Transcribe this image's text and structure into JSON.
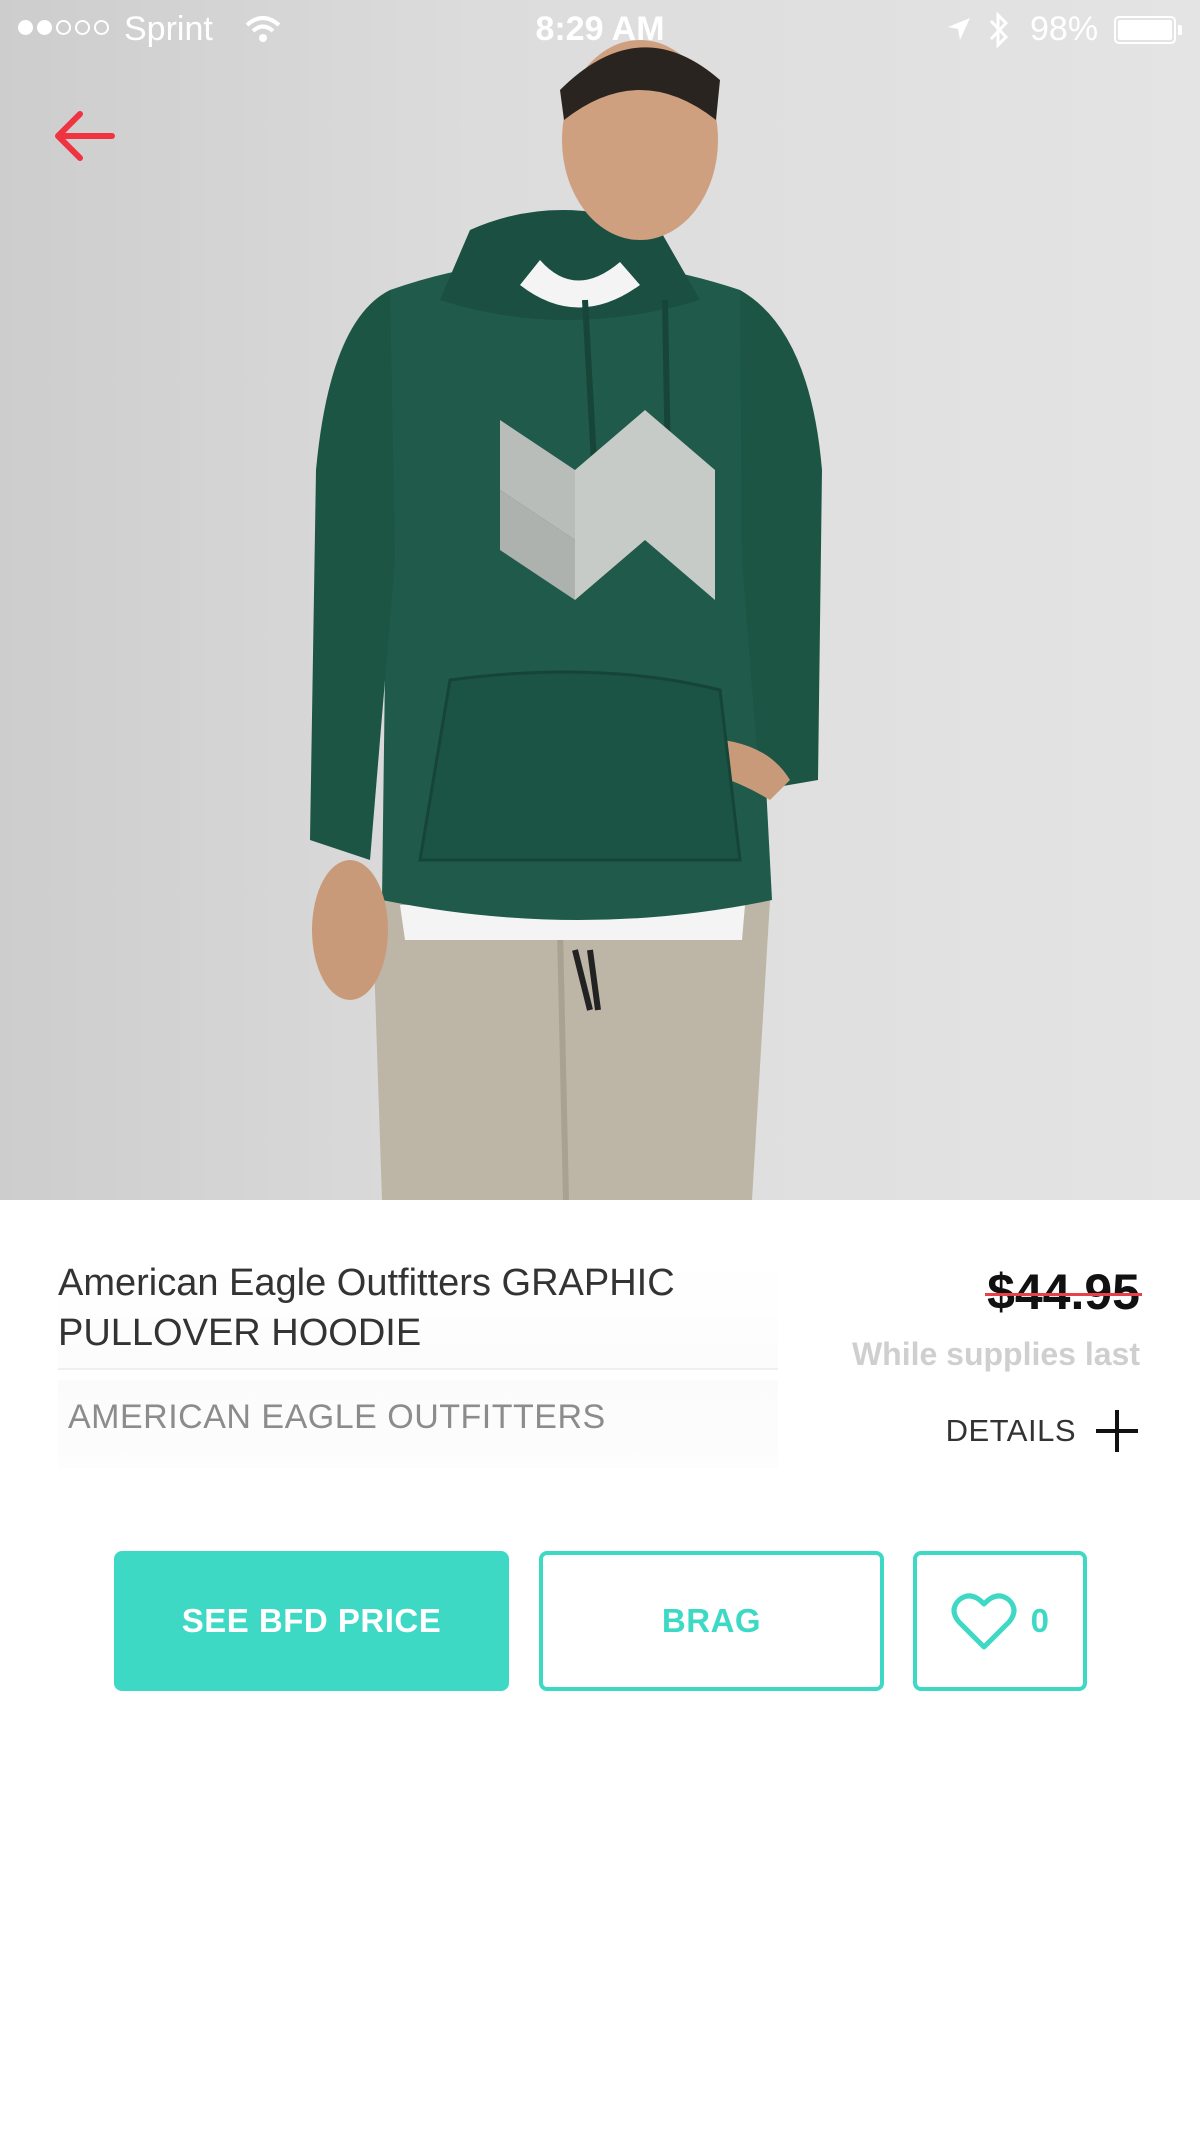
{
  "status_bar": {
    "carrier": "Sprint",
    "time": "8:29 AM",
    "battery": "98%"
  },
  "product": {
    "title": "American Eagle Outfitters GRAPHIC PULLOVER HOODIE",
    "brand": "AMERICAN EAGLE OUTFITTERS",
    "price": "$44.95",
    "supply_note": "While supplies last",
    "details_label": "DETAILS"
  },
  "actions": {
    "primary_label": "SEE BFD PRICE",
    "brag_label": "BRAG",
    "like_count": "0"
  },
  "icons": {
    "back": "arrow-left-icon",
    "details": "plus-icon",
    "like": "heart-icon"
  },
  "colors": {
    "accent": "#3dd9c5",
    "back_arrow": "#ef3340",
    "strike": "#e8414b"
  }
}
